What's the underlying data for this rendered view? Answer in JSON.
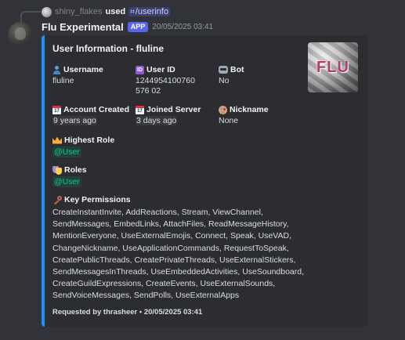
{
  "reply": {
    "username": "shiny_flakes",
    "used_text": "used",
    "command": "/userinfo"
  },
  "message": {
    "author": "Flu Experimental",
    "badge": "APP",
    "timestamp": "20/05/2025 03:41"
  },
  "embed": {
    "title": "User Information - fluline",
    "accent_color": "#1e90ff",
    "thumbnail_text": "FLU",
    "fields_row1": [
      {
        "icon": "bust-icon",
        "name": "Username",
        "value": "fluline"
      },
      {
        "icon": "id-icon",
        "name": "User ID",
        "value": "1244954100760576 02"
      },
      {
        "icon": "robot-icon",
        "name": "Bot",
        "value": "No"
      }
    ],
    "fields_row2": [
      {
        "icon": "calendar-icon",
        "name": "Account Created",
        "value": "9 years ago"
      },
      {
        "icon": "calendar-icon",
        "name": "Joined Server",
        "value": "3 days ago"
      },
      {
        "icon": "palette-icon",
        "name": "Nickname",
        "value": "None"
      }
    ],
    "highest_role": {
      "icon": "crown-icon",
      "name": "Highest Role",
      "value": "@User"
    },
    "roles": {
      "icon": "masks-icon",
      "name": "Roles",
      "value": "@User"
    },
    "key_permissions": {
      "icon": "key-icon",
      "name": "Key Permissions",
      "value": "CreateInstantInvite, AddReactions, Stream, ViewChannel, SendMessages, EmbedLinks, AttachFiles, ReadMessageHistory, MentionEveryone, UseExternalEmojis, Connect, Speak, UseVAD, ChangeNickname, UseApplicationCommands, RequestToSpeak, CreatePublicThreads, CreatePrivateThreads, UseExternalStickers, SendMessagesInThreads, UseEmbeddedActivities, UseSoundboard, CreateGuildExpressions, CreateEvents, UseExternalSounds, SendVoiceMessages, SendPolls, UseExternalApps"
    },
    "footer": "Requested by thrasheer • 20/05/2025 03:41"
  }
}
